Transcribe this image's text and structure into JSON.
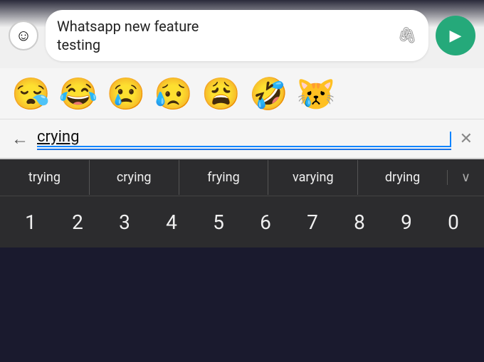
{
  "topbar": {
    "emoji_placeholder": "☺",
    "message_text": "Whatsapp new feature\ntesting",
    "attach_symbol": "🖇",
    "send_symbol": "▶"
  },
  "emoji_suggestions": {
    "emojis": [
      "😪",
      "😂",
      "😢",
      "😥",
      "😩",
      "🤣",
      "😿"
    ]
  },
  "search_bar": {
    "back_label": "←",
    "search_text": "crying",
    "close_label": "✕"
  },
  "suggestions": {
    "items": [
      "trying",
      "crying",
      "frying",
      "varying",
      "drying"
    ],
    "chevron": "∨"
  },
  "number_row": {
    "keys": [
      "1",
      "2",
      "3",
      "4",
      "5",
      "6",
      "7",
      "8",
      "9",
      "0"
    ]
  }
}
